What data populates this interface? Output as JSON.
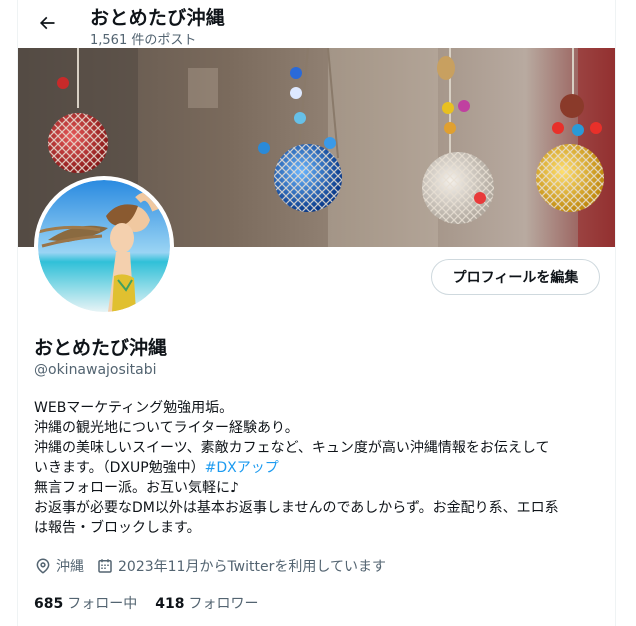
{
  "header": {
    "back_icon": "arrow-left-icon",
    "title": "おとめたび沖縄",
    "post_count": "1,561 件のポスト"
  },
  "profile": {
    "edit_button": "プロフィールを編集",
    "display_name": "おとめたび沖縄",
    "handle": "@okinawajositabi",
    "bio": {
      "line1": "WEBマーケティング勉強用垢。",
      "line2": "沖縄の観光地についてライター経験あり。",
      "line3": "沖縄の美味しいスイーツ、素敵カフェなど、キュン度が高い沖縄情報をお伝えして",
      "line4_text": "いきます。（DXUP勉強中）",
      "line4_hashtag": "#DXアップ",
      "line5": "無言フォロー派。お互い気軽に♪",
      "line6": "お返事が必要なDM以外は基本お返事しませんのであしからず。お金配り系、エロ系",
      "line7": "は報告・ブロックします。"
    },
    "location": "沖縄",
    "joined": "2023年11月からTwitterを利用しています",
    "following_count": "685",
    "following_label": "フォロー中",
    "followers_count": "418",
    "followers_label": "フォロワー"
  },
  "colors": {
    "accent": "#1d9bf0",
    "text_primary": "#0f1419",
    "text_secondary": "#536471",
    "border": "#cfd9de"
  }
}
